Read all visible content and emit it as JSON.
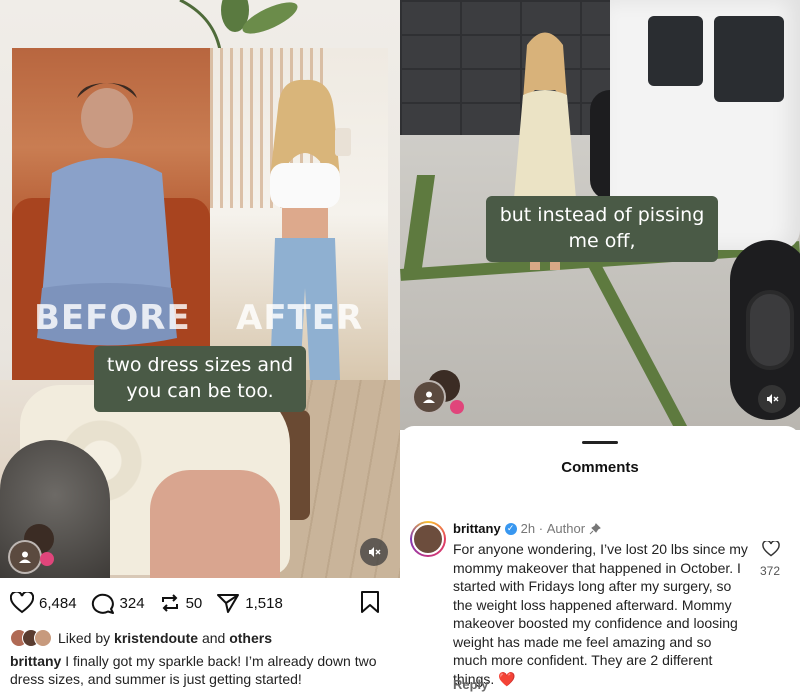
{
  "left_post": {
    "overlay": {
      "before_label": "BEFORE",
      "after_label": "AFTER",
      "caption": "two dress sizes and you can be too."
    },
    "actions": {
      "likes": "6,484",
      "comments": "324",
      "reposts": "50",
      "shares": "1,518"
    },
    "liked_by": {
      "prefix": "Liked by",
      "user": "kristendoute",
      "connector": "and",
      "others": "others"
    },
    "caption": {
      "username": "brittany",
      "text": "I finally got my sparkle back! I’m already down two dress sizes, and summer is just getting started!"
    }
  },
  "right_post": {
    "overlay": {
      "caption": "but instead of pissing me off,"
    },
    "comments_sheet": {
      "title": "Comments",
      "comment": {
        "username": "brittany",
        "time": "2h",
        "separator": "·",
        "role": "Author",
        "text": "For anyone wondering, I’ve lost 20 lbs since my mommy makeover that happened in October. I started with Fridays long after my surgery, so the weight loss happened afterward. Mommy makeover boosted my confidence and loosing weight has made me feel amazing and so much more confident. They are 2 different things. ❤️",
        "likes": "372",
        "reply_label": "Reply"
      }
    }
  },
  "colors": {
    "caption_box": "#4a5a46",
    "verified": "#3897f0",
    "heart_badge": "#e0457b"
  },
  "icons": [
    "heart-icon",
    "comment-icon",
    "repost-icon",
    "share-icon",
    "bookmark-icon",
    "mute-icon",
    "user-icon",
    "verified-icon",
    "pin-icon"
  ]
}
